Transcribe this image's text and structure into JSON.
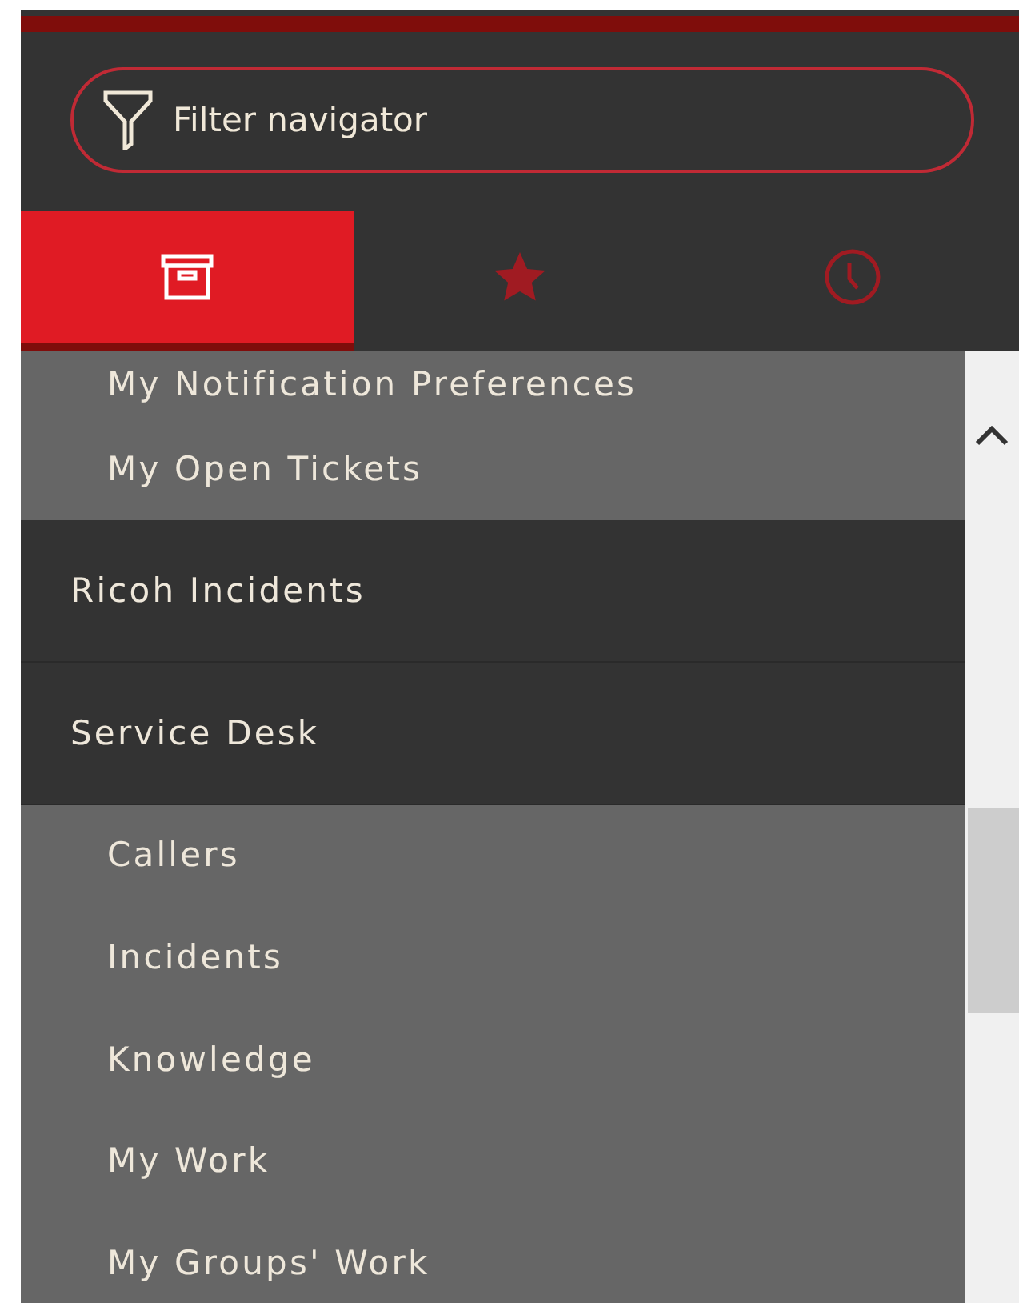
{
  "filter": {
    "placeholder": "Filter navigator"
  },
  "tabs": [
    {
      "kind": "archive",
      "selected": true
    },
    {
      "kind": "star",
      "selected": false
    },
    {
      "kind": "clock",
      "selected": false
    }
  ],
  "navigator": [
    {
      "children": [
        {
          "label": "My Notification Preferences"
        },
        {
          "label": "My Open Tickets"
        }
      ]
    },
    {
      "label": "Ricoh Incidents"
    },
    {
      "label": "Service Desk",
      "children": [
        {
          "label": "Callers"
        },
        {
          "label": "Incidents"
        },
        {
          "label": "Knowledge"
        },
        {
          "label": "My Work"
        },
        {
          "label": "My Groups' Work"
        }
      ]
    }
  ]
}
